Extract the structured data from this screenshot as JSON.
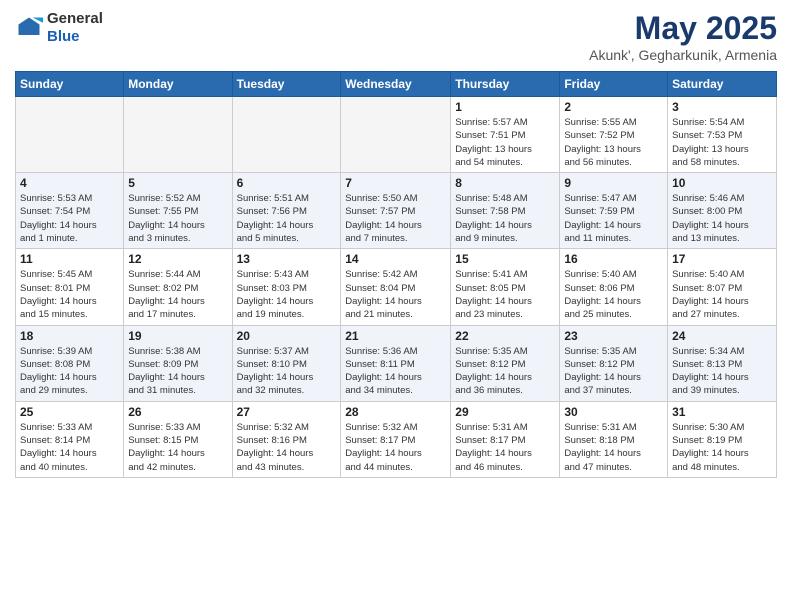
{
  "header": {
    "logo_general": "General",
    "logo_blue": "Blue",
    "title": "May 2025",
    "location": "Akunk', Gegharkunik, Armenia"
  },
  "days_of_week": [
    "Sunday",
    "Monday",
    "Tuesday",
    "Wednesday",
    "Thursday",
    "Friday",
    "Saturday"
  ],
  "weeks": [
    [
      {
        "day": "",
        "info": ""
      },
      {
        "day": "",
        "info": ""
      },
      {
        "day": "",
        "info": ""
      },
      {
        "day": "",
        "info": ""
      },
      {
        "day": "1",
        "info": "Sunrise: 5:57 AM\nSunset: 7:51 PM\nDaylight: 13 hours\nand 54 minutes."
      },
      {
        "day": "2",
        "info": "Sunrise: 5:55 AM\nSunset: 7:52 PM\nDaylight: 13 hours\nand 56 minutes."
      },
      {
        "day": "3",
        "info": "Sunrise: 5:54 AM\nSunset: 7:53 PM\nDaylight: 13 hours\nand 58 minutes."
      }
    ],
    [
      {
        "day": "4",
        "info": "Sunrise: 5:53 AM\nSunset: 7:54 PM\nDaylight: 14 hours\nand 1 minute."
      },
      {
        "day": "5",
        "info": "Sunrise: 5:52 AM\nSunset: 7:55 PM\nDaylight: 14 hours\nand 3 minutes."
      },
      {
        "day": "6",
        "info": "Sunrise: 5:51 AM\nSunset: 7:56 PM\nDaylight: 14 hours\nand 5 minutes."
      },
      {
        "day": "7",
        "info": "Sunrise: 5:50 AM\nSunset: 7:57 PM\nDaylight: 14 hours\nand 7 minutes."
      },
      {
        "day": "8",
        "info": "Sunrise: 5:48 AM\nSunset: 7:58 PM\nDaylight: 14 hours\nand 9 minutes."
      },
      {
        "day": "9",
        "info": "Sunrise: 5:47 AM\nSunset: 7:59 PM\nDaylight: 14 hours\nand 11 minutes."
      },
      {
        "day": "10",
        "info": "Sunrise: 5:46 AM\nSunset: 8:00 PM\nDaylight: 14 hours\nand 13 minutes."
      }
    ],
    [
      {
        "day": "11",
        "info": "Sunrise: 5:45 AM\nSunset: 8:01 PM\nDaylight: 14 hours\nand 15 minutes."
      },
      {
        "day": "12",
        "info": "Sunrise: 5:44 AM\nSunset: 8:02 PM\nDaylight: 14 hours\nand 17 minutes."
      },
      {
        "day": "13",
        "info": "Sunrise: 5:43 AM\nSunset: 8:03 PM\nDaylight: 14 hours\nand 19 minutes."
      },
      {
        "day": "14",
        "info": "Sunrise: 5:42 AM\nSunset: 8:04 PM\nDaylight: 14 hours\nand 21 minutes."
      },
      {
        "day": "15",
        "info": "Sunrise: 5:41 AM\nSunset: 8:05 PM\nDaylight: 14 hours\nand 23 minutes."
      },
      {
        "day": "16",
        "info": "Sunrise: 5:40 AM\nSunset: 8:06 PM\nDaylight: 14 hours\nand 25 minutes."
      },
      {
        "day": "17",
        "info": "Sunrise: 5:40 AM\nSunset: 8:07 PM\nDaylight: 14 hours\nand 27 minutes."
      }
    ],
    [
      {
        "day": "18",
        "info": "Sunrise: 5:39 AM\nSunset: 8:08 PM\nDaylight: 14 hours\nand 29 minutes."
      },
      {
        "day": "19",
        "info": "Sunrise: 5:38 AM\nSunset: 8:09 PM\nDaylight: 14 hours\nand 31 minutes."
      },
      {
        "day": "20",
        "info": "Sunrise: 5:37 AM\nSunset: 8:10 PM\nDaylight: 14 hours\nand 32 minutes."
      },
      {
        "day": "21",
        "info": "Sunrise: 5:36 AM\nSunset: 8:11 PM\nDaylight: 14 hours\nand 34 minutes."
      },
      {
        "day": "22",
        "info": "Sunrise: 5:35 AM\nSunset: 8:12 PM\nDaylight: 14 hours\nand 36 minutes."
      },
      {
        "day": "23",
        "info": "Sunrise: 5:35 AM\nSunset: 8:12 PM\nDaylight: 14 hours\nand 37 minutes."
      },
      {
        "day": "24",
        "info": "Sunrise: 5:34 AM\nSunset: 8:13 PM\nDaylight: 14 hours\nand 39 minutes."
      }
    ],
    [
      {
        "day": "25",
        "info": "Sunrise: 5:33 AM\nSunset: 8:14 PM\nDaylight: 14 hours\nand 40 minutes."
      },
      {
        "day": "26",
        "info": "Sunrise: 5:33 AM\nSunset: 8:15 PM\nDaylight: 14 hours\nand 42 minutes."
      },
      {
        "day": "27",
        "info": "Sunrise: 5:32 AM\nSunset: 8:16 PM\nDaylight: 14 hours\nand 43 minutes."
      },
      {
        "day": "28",
        "info": "Sunrise: 5:32 AM\nSunset: 8:17 PM\nDaylight: 14 hours\nand 44 minutes."
      },
      {
        "day": "29",
        "info": "Sunrise: 5:31 AM\nSunset: 8:17 PM\nDaylight: 14 hours\nand 46 minutes."
      },
      {
        "day": "30",
        "info": "Sunrise: 5:31 AM\nSunset: 8:18 PM\nDaylight: 14 hours\nand 47 minutes."
      },
      {
        "day": "31",
        "info": "Sunrise: 5:30 AM\nSunset: 8:19 PM\nDaylight: 14 hours\nand 48 minutes."
      }
    ]
  ]
}
